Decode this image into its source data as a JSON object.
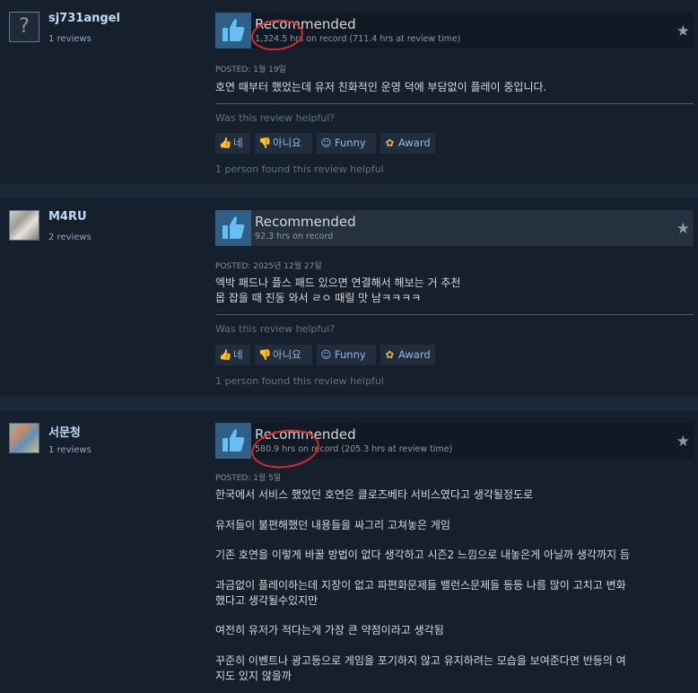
{
  "reviews": [
    {
      "author": "sj731angel",
      "review_count": "1 reviews",
      "avatar_icon": "question-mark-avatar",
      "recommendation": "Recommended",
      "hours": "1,324.5 hrs on record (711.4 hrs at review time)",
      "posted": "POSTED: 1월 19일",
      "body": [
        "호연 때부터 했었는데 유저 친화적인 운영 덕에 부담없이 플레이 중입니다."
      ],
      "helpful_question": "Was this review helpful?",
      "buttons": {
        "yes": "네",
        "no": "아니요",
        "funny": "Funny",
        "award": "Award"
      },
      "found_helpful": "1 person found this review helpful"
    },
    {
      "author": "M4RU",
      "review_count": "2 reviews",
      "avatar_icon": "user-avatar",
      "recommendation": "Recommended",
      "hours": "92.3 hrs on record",
      "posted": "POSTED: 2025년 12월 27일",
      "body": [
        "엑박 패드나 플스 패드 있으면 연결해서 해보는 거 추천",
        "몹 잡을 때 진동 와서 ㄹㅇ 때릴 맛 남ㅋㅋㅋㅋ"
      ],
      "helpful_question": "Was this review helpful?",
      "buttons": {
        "yes": "네",
        "no": "아니요",
        "funny": "Funny",
        "award": "Award"
      },
      "found_helpful": "1 person found this review helpful"
    },
    {
      "author": "서문청",
      "review_count": "1 reviews",
      "avatar_icon": "user-avatar",
      "recommendation": "Recommended",
      "hours": "580.9 hrs on record (205.3 hrs at review time)",
      "posted": "POSTED: 1월 5일",
      "body": [
        "한국에서 서비스 했었던 호연은 클로즈베타 서비스였다고 생각될정도로",
        "유저들이 불편해했던 내용들을 싸그리 고쳐놓은 게임",
        "기존 호연을 이렇게 바꿀 방법이 없다 생각하고 시즌2 느낌으로 내놓은게 아닐까 생각까지 듬",
        "과금없이 플레이하는데 지장이 없고 파편화문제들 밸런스문제들 등등 나름 많이 고치고 변화",
        "했다고 생각될수있지만",
        "여전히 유저가 적다는게 가장 큰 약점이라고 생각됨",
        "꾸준히 이벤트나 광고등으로 게임을 포기하지 않고 유지하려는 모습을 보여준다면 반등의 여",
        "지도 있지 않을까"
      ]
    }
  ],
  "colors": {
    "accent": "#66c0f4",
    "background": "#1b2838",
    "panel": "#16202d",
    "annotation": "#d42a2a"
  }
}
